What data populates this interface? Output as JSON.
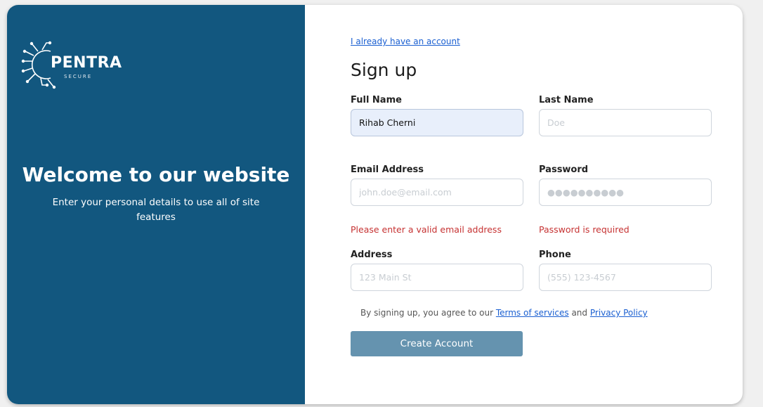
{
  "brand": {
    "name": "PENTRA",
    "tagline": "SECURE",
    "panel_color": "#12577f"
  },
  "welcome": {
    "title": "Welcome to our website",
    "subtitle": "Enter your personal details to use all of site features"
  },
  "form": {
    "already_link": "I already have an account",
    "title": "Sign up",
    "full_name": {
      "label": "Full Name",
      "value": "Rihab Cherni",
      "placeholder": ""
    },
    "last_name": {
      "label": "Last Name",
      "value": "",
      "placeholder": "Doe"
    },
    "email": {
      "label": "Email Address",
      "value": "",
      "placeholder": "john.doe@email.com",
      "error": "Please enter a valid email address"
    },
    "password": {
      "label": "Password",
      "value": "",
      "placeholder": "●●●●●●●●●●",
      "error": "Password is required"
    },
    "address": {
      "label": "Address",
      "value": "",
      "placeholder": "123 Main St"
    },
    "phone": {
      "label": "Phone",
      "value": "",
      "placeholder": "(555) 123-4567"
    },
    "agree": {
      "prefix": "By signing up, you agree to our",
      "terms_link": "Terms of services",
      "joiner": "and",
      "privacy_link": "Privacy Policy"
    },
    "submit_label": "Create Account",
    "button_color": "#6593af",
    "error_color": "#c63232",
    "link_color": "#1a5fd1"
  }
}
